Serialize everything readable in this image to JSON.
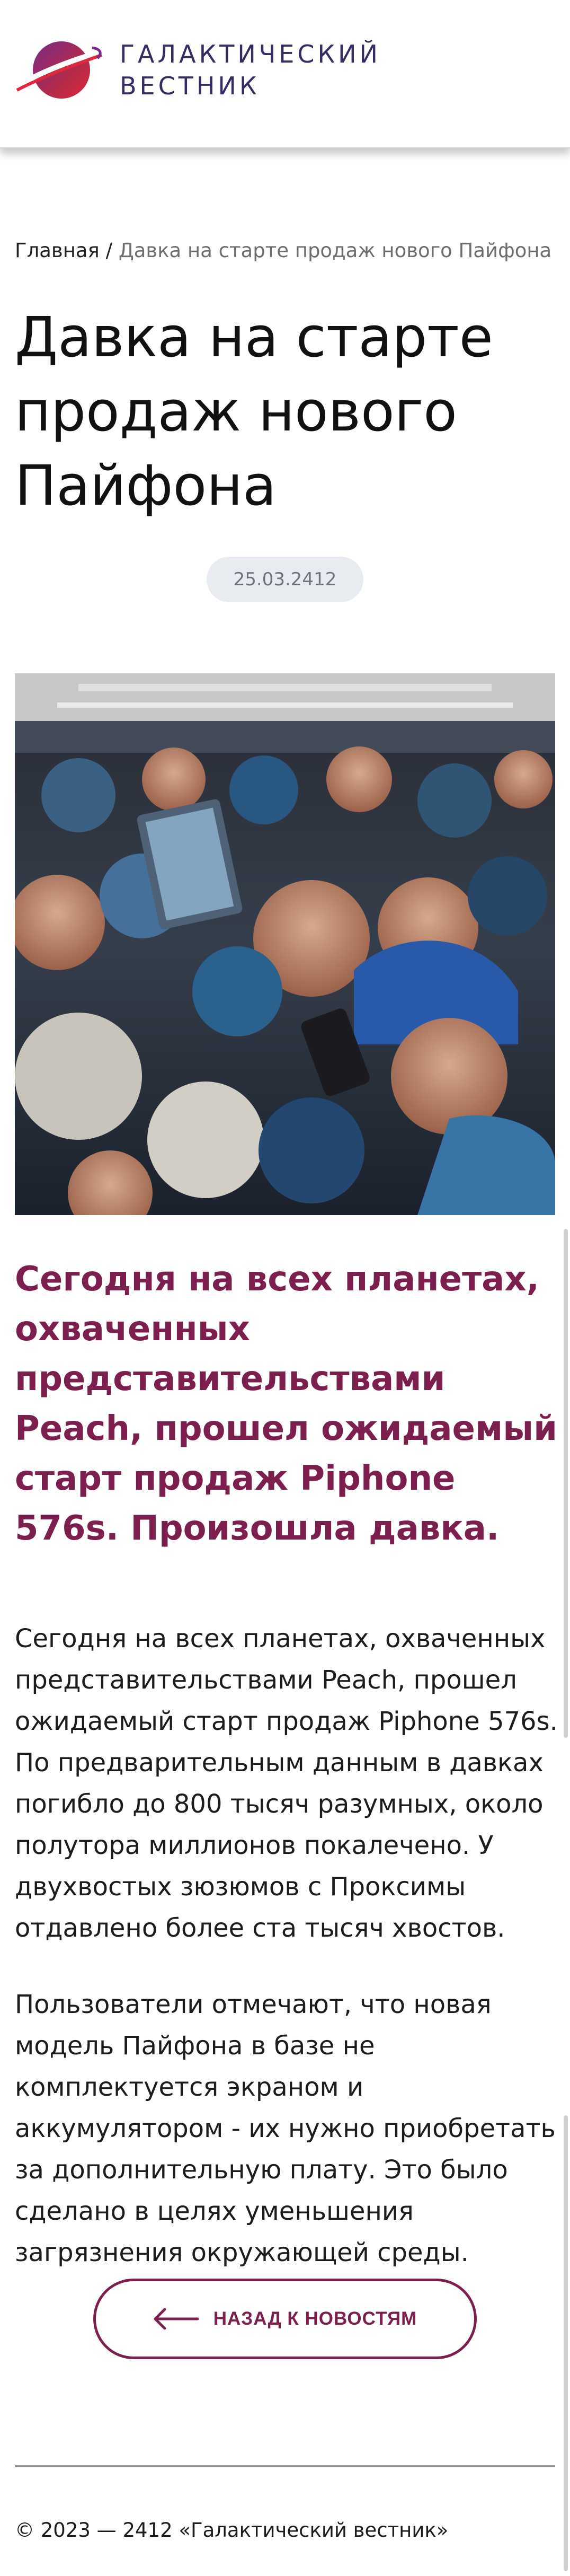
{
  "header": {
    "logo_line1": "ГАЛАКТИЧЕСКИЙ",
    "logo_line2": "ВЕСТНИК",
    "logo_icon": "planet-ring-logo-icon"
  },
  "breadcrumb": {
    "home": "Главная",
    "separator": " / ",
    "current": "Давка на старте продаж нового Пайфона"
  },
  "article": {
    "title": "Давка на старте продаж нового Пайфона",
    "date": "25.03.2412",
    "lead": "Сегодня на всех планетах, охваченных представительствами Peach, прошел ожидаемый старт продаж Piphone 576s. Произошла давка.",
    "paragraphs": [
      "Сегодня на всех планетах, охваченных представительствами Peach, прошел ожидаемый старт продаж Piphone 576s. По предварительным данным в давках погибло до 800 тысяч разумных, около полутора миллионов покалечено. У двухвостых зюзюмов с Проксимы отдавлено более ста тысяч хвостов.",
      "Пользователи отмечают, что новая модель Пайфона в базе не комплектуется экраном и аккумулятором - их нужно приобретать за дополнительную плату. Это было сделано в целях уменьшения загрязнения окружающей среды."
    ]
  },
  "back_button": {
    "label": "НАЗАД К НОВОСТЯМ",
    "icon": "arrow-left-icon"
  },
  "footer": {
    "copyright": "© 2023 — 2412 «Галактический вестник»"
  },
  "colors": {
    "accent": "#7d1f4e",
    "logo_text": "#342c63",
    "date_badge_bg": "#e8ebf0"
  }
}
